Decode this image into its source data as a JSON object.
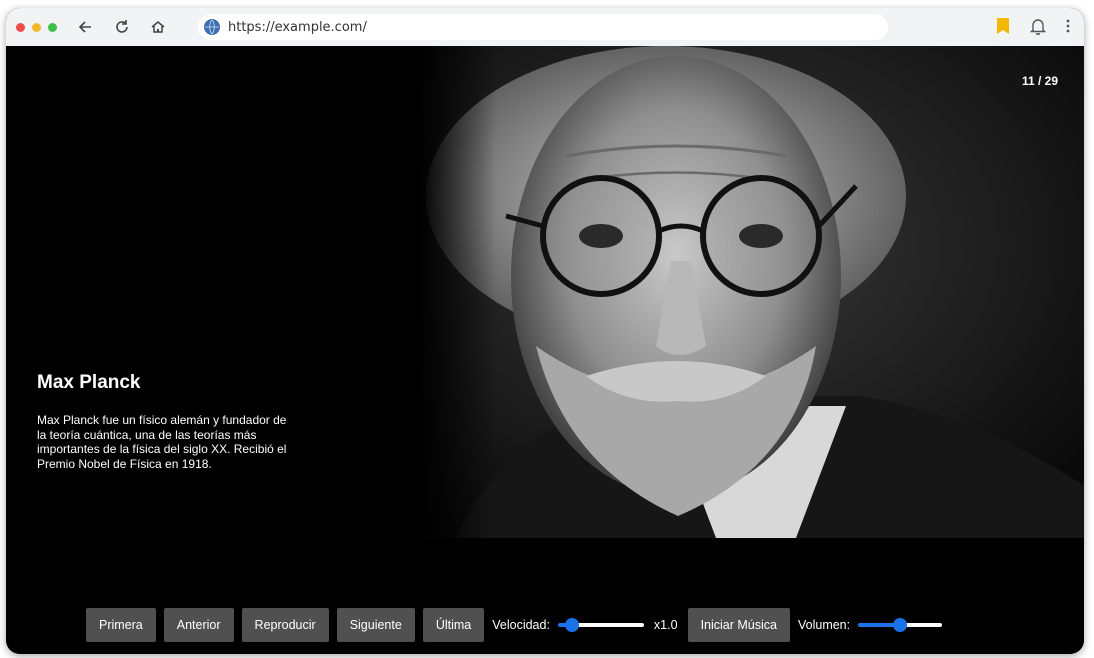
{
  "browser": {
    "url": "https://example.com/",
    "icons": [
      "back-icon",
      "reload-icon",
      "home-icon",
      "globe-icon",
      "bookmark-icon",
      "bell-icon",
      "menu-icon"
    ]
  },
  "slide": {
    "counter": "11 / 29",
    "title": "Max Planck",
    "description": "Max Planck fue un físico alemán y fundador de la teoría cuántica, una de las teorías más importantes de la física del siglo XX. Recibió el Premio Nobel de Física en 1918."
  },
  "controls": {
    "first": "Primera",
    "previous": "Anterior",
    "play": "Reproducir",
    "next": "Siguiente",
    "last": "Última",
    "speed_label": "Velocidad:",
    "speed_value": "x1.0",
    "speed_level": 0.1,
    "music": "Iniciar Música",
    "volume_label": "Volumen:",
    "volume_level": 0.5
  },
  "colors": {
    "accent": "#1a73e8",
    "button": "#505050",
    "background": "#000000"
  }
}
